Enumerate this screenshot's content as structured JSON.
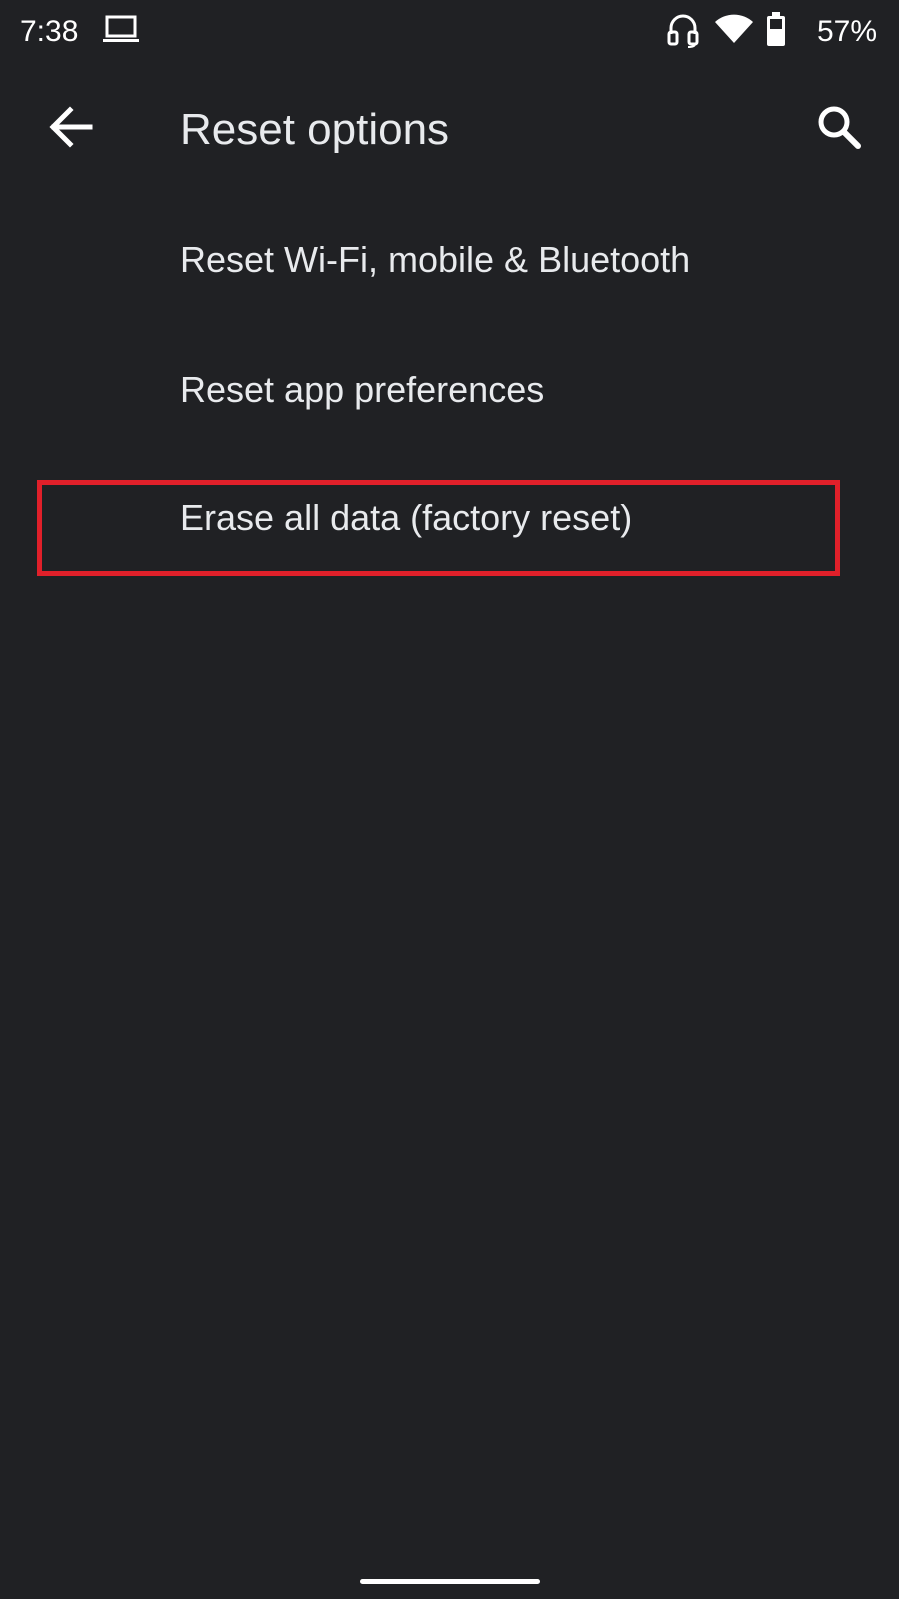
{
  "status_bar": {
    "time": "7:38",
    "battery_percent": "57%",
    "icons": [
      "laptop-icon",
      "headset-icon",
      "wifi-icon",
      "battery-icon"
    ]
  },
  "app_bar": {
    "title": "Reset options",
    "back_icon": "arrow-back-icon",
    "search_icon": "search-icon"
  },
  "reset_options": [
    {
      "label": "Reset Wi-Fi, mobile & Bluetooth"
    },
    {
      "label": "Reset app preferences"
    },
    {
      "label": "Erase all data (factory reset)",
      "highlighted": true
    }
  ],
  "colors": {
    "background": "#202124",
    "text": "#e8eaed",
    "highlight": "#e0202a"
  }
}
